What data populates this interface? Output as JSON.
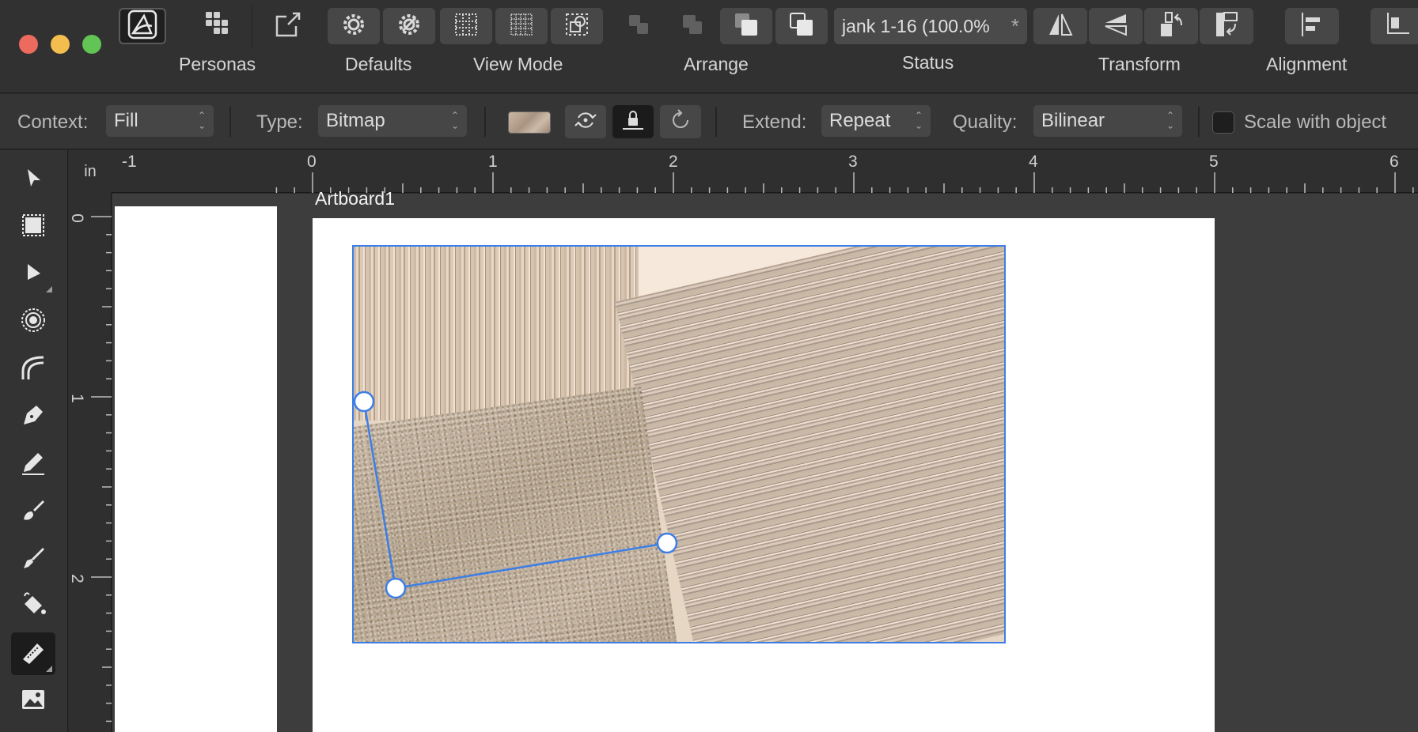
{
  "toolbar": {
    "groups": {
      "personas": "Personas",
      "defaults": "Defaults",
      "view_mode": "View Mode",
      "arrange": "Arrange",
      "status": "Status",
      "transform": "Transform",
      "alignment": "Alignment"
    },
    "status_text": "jank 1-16 (100.0%",
    "status_modified": "*"
  },
  "context": {
    "context_label": "Context:",
    "context_value": "Fill",
    "type_label": "Type:",
    "type_value": "Bitmap",
    "extend_label": "Extend:",
    "extend_value": "Repeat",
    "quality_label": "Quality:",
    "quality_value": "Bilinear",
    "scale_label": "Scale with object",
    "scale_checked": false
  },
  "ruler": {
    "unit": "in",
    "h_ticks": [
      "-1",
      "0",
      "1",
      "2",
      "3",
      "4",
      "5",
      "6"
    ],
    "v_ticks": [
      "0",
      "1",
      "2"
    ]
  },
  "canvas": {
    "artboard_title": "Artboard1"
  },
  "colors": {
    "accent": "#3d7ee6",
    "close": "#ed6a5e",
    "minimize": "#f4be4f",
    "zoom": "#61c454"
  }
}
